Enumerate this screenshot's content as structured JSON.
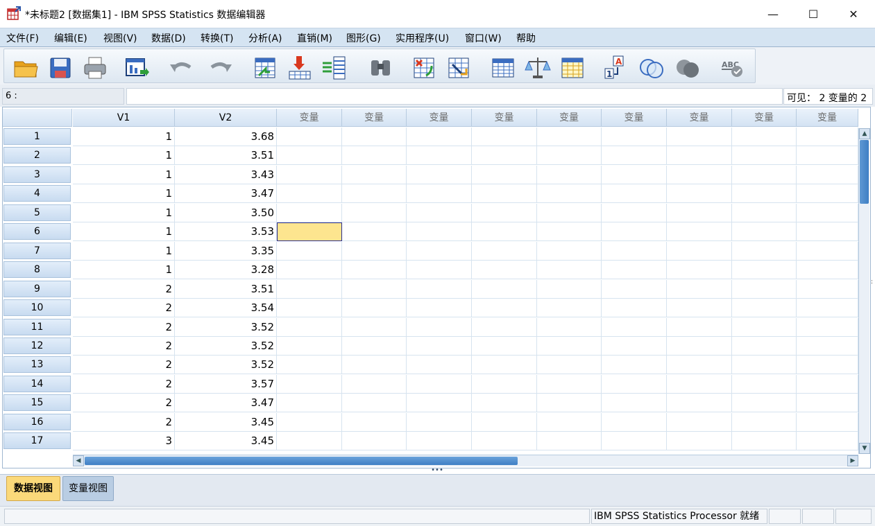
{
  "window": {
    "title": "*未标题2 [数据集1] - IBM SPSS Statistics 数据编辑器",
    "minimize_glyph": "—",
    "maximize_glyph": "☐",
    "close_glyph": "✕"
  },
  "menu": [
    {
      "label": "文件(F)"
    },
    {
      "label": "编辑(E)"
    },
    {
      "label": "视图(V)"
    },
    {
      "label": "数据(D)"
    },
    {
      "label": "转换(T)"
    },
    {
      "label": "分析(A)"
    },
    {
      "label": "直销(M)"
    },
    {
      "label": "图形(G)"
    },
    {
      "label": "实用程序(U)"
    },
    {
      "label": "窗口(W)"
    },
    {
      "label": "帮助"
    }
  ],
  "toolbar": {
    "icons": [
      "open-folder-icon",
      "save-icon",
      "print-icon",
      "recall-dialog-icon",
      "undo-icon",
      "redo-icon",
      "goto-case-icon",
      "goto-variable-icon",
      "variables-icon",
      "find-icon",
      "insert-cases-icon",
      "insert-variable-icon",
      "split-file-icon",
      "weight-cases-icon",
      "select-cases-icon",
      "value-labels-icon",
      "use-variable-sets-icon",
      "show-all-variables-icon",
      "spell-check-icon"
    ]
  },
  "editor": {
    "cell_ref": "6 :",
    "cell_value": "",
    "visible_count": "可见： 2 变量的 2"
  },
  "grid": {
    "columns": [
      "V1",
      "V2",
      "变量",
      "变量",
      "变量",
      "变量",
      "变量",
      "变量",
      "变量",
      "变量",
      "变量"
    ],
    "rows": [
      {
        "n": "1",
        "v1": "1",
        "v2": "3.68"
      },
      {
        "n": "2",
        "v1": "1",
        "v2": "3.51"
      },
      {
        "n": "3",
        "v1": "1",
        "v2": "3.43"
      },
      {
        "n": "4",
        "v1": "1",
        "v2": "3.47"
      },
      {
        "n": "5",
        "v1": "1",
        "v2": "3.50"
      },
      {
        "n": "6",
        "v1": "1",
        "v2": "3.53"
      },
      {
        "n": "7",
        "v1": "1",
        "v2": "3.35"
      },
      {
        "n": "8",
        "v1": "1",
        "v2": "3.28"
      },
      {
        "n": "9",
        "v1": "2",
        "v2": "3.51"
      },
      {
        "n": "10",
        "v1": "2",
        "v2": "3.54"
      },
      {
        "n": "11",
        "v1": "2",
        "v2": "3.52"
      },
      {
        "n": "12",
        "v1": "2",
        "v2": "3.52"
      },
      {
        "n": "13",
        "v1": "2",
        "v2": "3.52"
      },
      {
        "n": "14",
        "v1": "2",
        "v2": "3.57"
      },
      {
        "n": "15",
        "v1": "2",
        "v2": "3.47"
      },
      {
        "n": "16",
        "v1": "2",
        "v2": "3.45"
      },
      {
        "n": "17",
        "v1": "3",
        "v2": "3.45"
      }
    ],
    "selected_row": "6",
    "selected_column": "变量",
    "selected_color": "#fde58f"
  },
  "tabs": {
    "data_view": "数据视图",
    "variable_view": "变量视图"
  },
  "status": {
    "processor": "IBM SPSS Statistics Processor 就绪"
  },
  "colors": {
    "menubar": "#d5e4f2",
    "active_tab": "#fbd97a",
    "scroll_thumb": "#3f7fc4"
  }
}
